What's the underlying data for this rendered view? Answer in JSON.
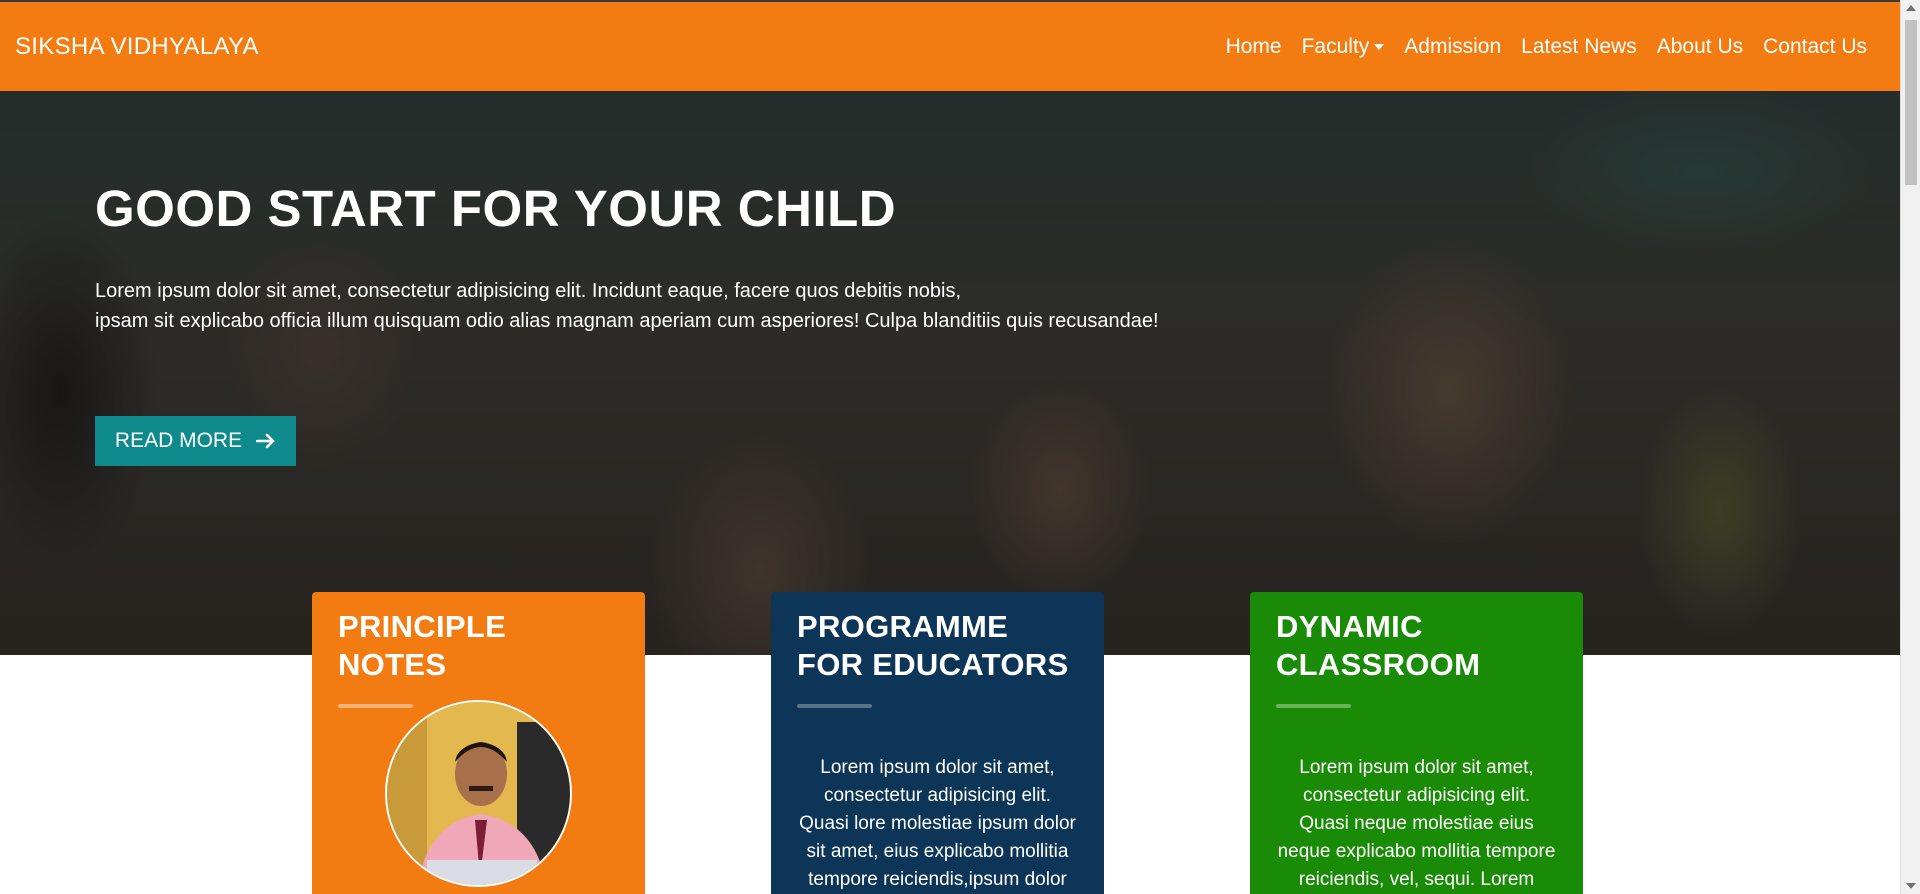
{
  "navbar": {
    "brand": "SIKSHA VIDHYALAYA",
    "links": [
      {
        "label": "Home"
      },
      {
        "label": "Faculty",
        "dropdown": true
      },
      {
        "label": "Admission"
      },
      {
        "label": "Latest News"
      },
      {
        "label": "About Us"
      },
      {
        "label": "Contact Us"
      }
    ],
    "background_color": "#f27c12"
  },
  "hero": {
    "title": "GOOD START FOR YOUR CHILD",
    "text_line_1": "Lorem ipsum dolor sit amet, consectetur adipisicing elit. Incidunt eaque, facere quos debitis nobis,",
    "text_line_2": "ipsam sit explicabo officia illum quisquam odio alias magnam aperiam cum asperiores! Culpa blanditiis quis recusandae!",
    "button_label": "READ MORE",
    "button_icon": "arrow-right-icon",
    "button_color": "#0f8a8c"
  },
  "cards": [
    {
      "title": "PRINCIPLE NOTES",
      "color": "#f27c12",
      "image": "principal-photo"
    },
    {
      "title": "PROGRAMME FOR EDUCATORS",
      "color": "#0d3558",
      "text": "Lorem ipsum dolor sit amet, consectetur adipisicing elit. Quasi lore molestiae ipsum dolor sit amet, eius explicabo mollitia tempore reiciendis,ipsum dolor sit"
    },
    {
      "title": "DYNAMIC CLASSROOM",
      "color": "#198b06",
      "text": "Lorem ipsum dolor sit amet, consectetur adipisicing elit. Quasi neque molestiae eius neque explicabo mollitia tempore reiciendis, vel, sequi. Lorem neque"
    }
  ]
}
